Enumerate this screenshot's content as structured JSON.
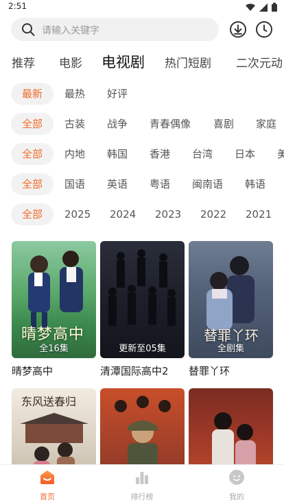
{
  "status_bar": {
    "time": "2:51"
  },
  "search": {
    "placeholder": "请输入关键字"
  },
  "categories": [
    "推荐",
    "电影",
    "电视剧",
    "热门短剧",
    "二次元动"
  ],
  "filters": {
    "sort": [
      "最新",
      "最热",
      "好评"
    ],
    "genre": [
      "全部",
      "古装",
      "战争",
      "青春偶像",
      "喜剧",
      "家庭"
    ],
    "region": [
      "全部",
      "内地",
      "韩国",
      "香港",
      "台湾",
      "日本",
      "美"
    ],
    "language": [
      "全部",
      "国语",
      "英语",
      "粤语",
      "闽南语",
      "韩语"
    ],
    "year": [
      "全部",
      "2025",
      "2024",
      "2023",
      "2022",
      "2021"
    ]
  },
  "posters": [
    {
      "title": "晴梦高中",
      "badge": "全16集",
      "art_text": "晴梦高中"
    },
    {
      "title": "清潭国际高中2",
      "badge": "更新至05集",
      "art_text": ""
    },
    {
      "title": "替罪丫环",
      "badge": "全剧集",
      "art_text": "替罪丫环"
    },
    {
      "title": "",
      "badge": "",
      "art_text": "东风送春归"
    },
    {
      "title": "",
      "badge": "",
      "art_text": ""
    },
    {
      "title": "",
      "badge": "",
      "art_text": ""
    }
  ],
  "bottom_nav": [
    {
      "label": "首页",
      "icon": "home-icon",
      "active": true
    },
    {
      "label": "排行榜",
      "icon": "ranking-icon",
      "active": false
    },
    {
      "label": "我的",
      "icon": "profile-icon",
      "active": false
    }
  ],
  "colors": {
    "accent": "#f06b2a"
  }
}
